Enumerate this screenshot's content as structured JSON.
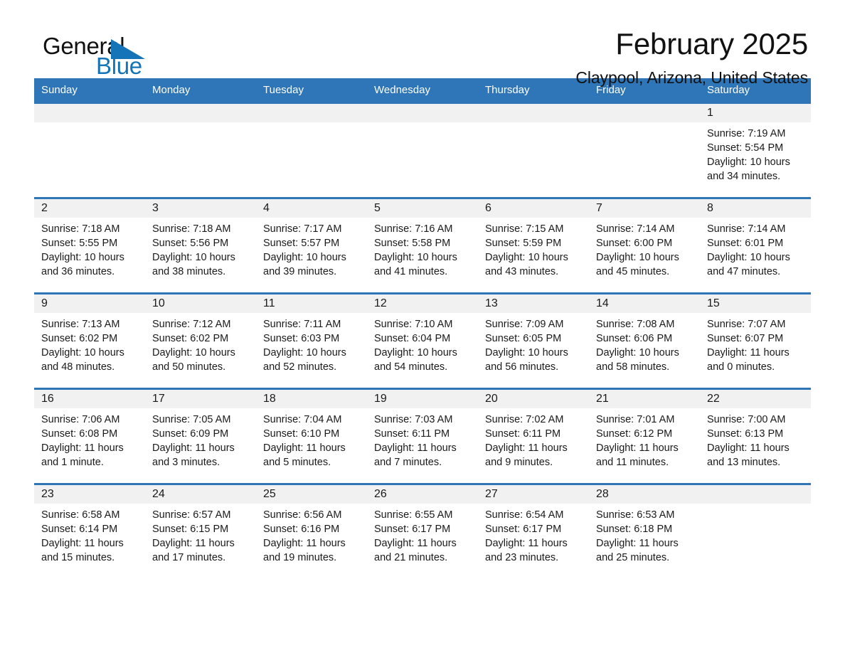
{
  "brand": {
    "name_part1": "General",
    "name_part2": "Blue",
    "triangle_color": "#1574b8",
    "icon": "brand-triangle-icon"
  },
  "header": {
    "title": "February 2025",
    "subtitle": "Claypool, Arizona, United States",
    "accent_color": "#2e76b8",
    "daynum_band_color": "#f1f1f1"
  },
  "weekday_headers": [
    "Sunday",
    "Monday",
    "Tuesday",
    "Wednesday",
    "Thursday",
    "Friday",
    "Saturday"
  ],
  "weeks": [
    [
      {
        "day": "",
        "sunrise": "",
        "sunset": "",
        "daylight_line1": "",
        "daylight_line2": "",
        "empty": true
      },
      {
        "day": "",
        "sunrise": "",
        "sunset": "",
        "daylight_line1": "",
        "daylight_line2": "",
        "empty": true
      },
      {
        "day": "",
        "sunrise": "",
        "sunset": "",
        "daylight_line1": "",
        "daylight_line2": "",
        "empty": true
      },
      {
        "day": "",
        "sunrise": "",
        "sunset": "",
        "daylight_line1": "",
        "daylight_line2": "",
        "empty": true
      },
      {
        "day": "",
        "sunrise": "",
        "sunset": "",
        "daylight_line1": "",
        "daylight_line2": "",
        "empty": true
      },
      {
        "day": "",
        "sunrise": "",
        "sunset": "",
        "daylight_line1": "",
        "daylight_line2": "",
        "empty": true
      },
      {
        "day": "1",
        "sunrise": "Sunrise: 7:19 AM",
        "sunset": "Sunset: 5:54 PM",
        "daylight_line1": "Daylight: 10 hours",
        "daylight_line2": "and 34 minutes.",
        "empty": false
      }
    ],
    [
      {
        "day": "2",
        "sunrise": "Sunrise: 7:18 AM",
        "sunset": "Sunset: 5:55 PM",
        "daylight_line1": "Daylight: 10 hours",
        "daylight_line2": "and 36 minutes.",
        "empty": false
      },
      {
        "day": "3",
        "sunrise": "Sunrise: 7:18 AM",
        "sunset": "Sunset: 5:56 PM",
        "daylight_line1": "Daylight: 10 hours",
        "daylight_line2": "and 38 minutes.",
        "empty": false
      },
      {
        "day": "4",
        "sunrise": "Sunrise: 7:17 AM",
        "sunset": "Sunset: 5:57 PM",
        "daylight_line1": "Daylight: 10 hours",
        "daylight_line2": "and 39 minutes.",
        "empty": false
      },
      {
        "day": "5",
        "sunrise": "Sunrise: 7:16 AM",
        "sunset": "Sunset: 5:58 PM",
        "daylight_line1": "Daylight: 10 hours",
        "daylight_line2": "and 41 minutes.",
        "empty": false
      },
      {
        "day": "6",
        "sunrise": "Sunrise: 7:15 AM",
        "sunset": "Sunset: 5:59 PM",
        "daylight_line1": "Daylight: 10 hours",
        "daylight_line2": "and 43 minutes.",
        "empty": false
      },
      {
        "day": "7",
        "sunrise": "Sunrise: 7:14 AM",
        "sunset": "Sunset: 6:00 PM",
        "daylight_line1": "Daylight: 10 hours",
        "daylight_line2": "and 45 minutes.",
        "empty": false
      },
      {
        "day": "8",
        "sunrise": "Sunrise: 7:14 AM",
        "sunset": "Sunset: 6:01 PM",
        "daylight_line1": "Daylight: 10 hours",
        "daylight_line2": "and 47 minutes.",
        "empty": false
      }
    ],
    [
      {
        "day": "9",
        "sunrise": "Sunrise: 7:13 AM",
        "sunset": "Sunset: 6:02 PM",
        "daylight_line1": "Daylight: 10 hours",
        "daylight_line2": "and 48 minutes.",
        "empty": false
      },
      {
        "day": "10",
        "sunrise": "Sunrise: 7:12 AM",
        "sunset": "Sunset: 6:02 PM",
        "daylight_line1": "Daylight: 10 hours",
        "daylight_line2": "and 50 minutes.",
        "empty": false
      },
      {
        "day": "11",
        "sunrise": "Sunrise: 7:11 AM",
        "sunset": "Sunset: 6:03 PM",
        "daylight_line1": "Daylight: 10 hours",
        "daylight_line2": "and 52 minutes.",
        "empty": false
      },
      {
        "day": "12",
        "sunrise": "Sunrise: 7:10 AM",
        "sunset": "Sunset: 6:04 PM",
        "daylight_line1": "Daylight: 10 hours",
        "daylight_line2": "and 54 minutes.",
        "empty": false
      },
      {
        "day": "13",
        "sunrise": "Sunrise: 7:09 AM",
        "sunset": "Sunset: 6:05 PM",
        "daylight_line1": "Daylight: 10 hours",
        "daylight_line2": "and 56 minutes.",
        "empty": false
      },
      {
        "day": "14",
        "sunrise": "Sunrise: 7:08 AM",
        "sunset": "Sunset: 6:06 PM",
        "daylight_line1": "Daylight: 10 hours",
        "daylight_line2": "and 58 minutes.",
        "empty": false
      },
      {
        "day": "15",
        "sunrise": "Sunrise: 7:07 AM",
        "sunset": "Sunset: 6:07 PM",
        "daylight_line1": "Daylight: 11 hours",
        "daylight_line2": "and 0 minutes.",
        "empty": false
      }
    ],
    [
      {
        "day": "16",
        "sunrise": "Sunrise: 7:06 AM",
        "sunset": "Sunset: 6:08 PM",
        "daylight_line1": "Daylight: 11 hours",
        "daylight_line2": "and 1 minute.",
        "empty": false
      },
      {
        "day": "17",
        "sunrise": "Sunrise: 7:05 AM",
        "sunset": "Sunset: 6:09 PM",
        "daylight_line1": "Daylight: 11 hours",
        "daylight_line2": "and 3 minutes.",
        "empty": false
      },
      {
        "day": "18",
        "sunrise": "Sunrise: 7:04 AM",
        "sunset": "Sunset: 6:10 PM",
        "daylight_line1": "Daylight: 11 hours",
        "daylight_line2": "and 5 minutes.",
        "empty": false
      },
      {
        "day": "19",
        "sunrise": "Sunrise: 7:03 AM",
        "sunset": "Sunset: 6:11 PM",
        "daylight_line1": "Daylight: 11 hours",
        "daylight_line2": "and 7 minutes.",
        "empty": false
      },
      {
        "day": "20",
        "sunrise": "Sunrise: 7:02 AM",
        "sunset": "Sunset: 6:11 PM",
        "daylight_line1": "Daylight: 11 hours",
        "daylight_line2": "and 9 minutes.",
        "empty": false
      },
      {
        "day": "21",
        "sunrise": "Sunrise: 7:01 AM",
        "sunset": "Sunset: 6:12 PM",
        "daylight_line1": "Daylight: 11 hours",
        "daylight_line2": "and 11 minutes.",
        "empty": false
      },
      {
        "day": "22",
        "sunrise": "Sunrise: 7:00 AM",
        "sunset": "Sunset: 6:13 PM",
        "daylight_line1": "Daylight: 11 hours",
        "daylight_line2": "and 13 minutes.",
        "empty": false
      }
    ],
    [
      {
        "day": "23",
        "sunrise": "Sunrise: 6:58 AM",
        "sunset": "Sunset: 6:14 PM",
        "daylight_line1": "Daylight: 11 hours",
        "daylight_line2": "and 15 minutes.",
        "empty": false
      },
      {
        "day": "24",
        "sunrise": "Sunrise: 6:57 AM",
        "sunset": "Sunset: 6:15 PM",
        "daylight_line1": "Daylight: 11 hours",
        "daylight_line2": "and 17 minutes.",
        "empty": false
      },
      {
        "day": "25",
        "sunrise": "Sunrise: 6:56 AM",
        "sunset": "Sunset: 6:16 PM",
        "daylight_line1": "Daylight: 11 hours",
        "daylight_line2": "and 19 minutes.",
        "empty": false
      },
      {
        "day": "26",
        "sunrise": "Sunrise: 6:55 AM",
        "sunset": "Sunset: 6:17 PM",
        "daylight_line1": "Daylight: 11 hours",
        "daylight_line2": "and 21 minutes.",
        "empty": false
      },
      {
        "day": "27",
        "sunrise": "Sunrise: 6:54 AM",
        "sunset": "Sunset: 6:17 PM",
        "daylight_line1": "Daylight: 11 hours",
        "daylight_line2": "and 23 minutes.",
        "empty": false
      },
      {
        "day": "28",
        "sunrise": "Sunrise: 6:53 AM",
        "sunset": "Sunset: 6:18 PM",
        "daylight_line1": "Daylight: 11 hours",
        "daylight_line2": "and 25 minutes.",
        "empty": false
      },
      {
        "day": "",
        "sunrise": "",
        "sunset": "",
        "daylight_line1": "",
        "daylight_line2": "",
        "empty": true
      }
    ]
  ]
}
